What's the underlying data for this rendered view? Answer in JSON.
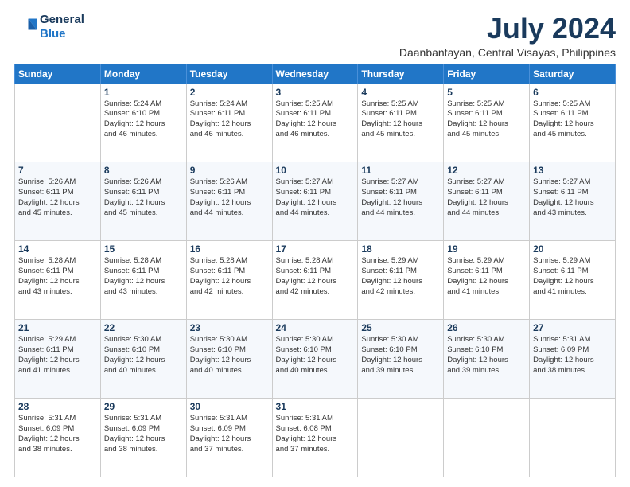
{
  "logo": {
    "line1": "General",
    "line2": "Blue"
  },
  "title": "July 2024",
  "location": "Daanbantayan, Central Visayas, Philippines",
  "days_of_week": [
    "Sunday",
    "Monday",
    "Tuesday",
    "Wednesday",
    "Thursday",
    "Friday",
    "Saturday"
  ],
  "weeks": [
    [
      {
        "day": "",
        "info": ""
      },
      {
        "day": "1",
        "info": "Sunrise: 5:24 AM\nSunset: 6:10 PM\nDaylight: 12 hours\nand 46 minutes."
      },
      {
        "day": "2",
        "info": "Sunrise: 5:24 AM\nSunset: 6:11 PM\nDaylight: 12 hours\nand 46 minutes."
      },
      {
        "day": "3",
        "info": "Sunrise: 5:25 AM\nSunset: 6:11 PM\nDaylight: 12 hours\nand 46 minutes."
      },
      {
        "day": "4",
        "info": "Sunrise: 5:25 AM\nSunset: 6:11 PM\nDaylight: 12 hours\nand 45 minutes."
      },
      {
        "day": "5",
        "info": "Sunrise: 5:25 AM\nSunset: 6:11 PM\nDaylight: 12 hours\nand 45 minutes."
      },
      {
        "day": "6",
        "info": "Sunrise: 5:25 AM\nSunset: 6:11 PM\nDaylight: 12 hours\nand 45 minutes."
      }
    ],
    [
      {
        "day": "7",
        "info": "Sunrise: 5:26 AM\nSunset: 6:11 PM\nDaylight: 12 hours\nand 45 minutes."
      },
      {
        "day": "8",
        "info": "Sunrise: 5:26 AM\nSunset: 6:11 PM\nDaylight: 12 hours\nand 45 minutes."
      },
      {
        "day": "9",
        "info": "Sunrise: 5:26 AM\nSunset: 6:11 PM\nDaylight: 12 hours\nand 44 minutes."
      },
      {
        "day": "10",
        "info": "Sunrise: 5:27 AM\nSunset: 6:11 PM\nDaylight: 12 hours\nand 44 minutes."
      },
      {
        "day": "11",
        "info": "Sunrise: 5:27 AM\nSunset: 6:11 PM\nDaylight: 12 hours\nand 44 minutes."
      },
      {
        "day": "12",
        "info": "Sunrise: 5:27 AM\nSunset: 6:11 PM\nDaylight: 12 hours\nand 44 minutes."
      },
      {
        "day": "13",
        "info": "Sunrise: 5:27 AM\nSunset: 6:11 PM\nDaylight: 12 hours\nand 43 minutes."
      }
    ],
    [
      {
        "day": "14",
        "info": "Sunrise: 5:28 AM\nSunset: 6:11 PM\nDaylight: 12 hours\nand 43 minutes."
      },
      {
        "day": "15",
        "info": "Sunrise: 5:28 AM\nSunset: 6:11 PM\nDaylight: 12 hours\nand 43 minutes."
      },
      {
        "day": "16",
        "info": "Sunrise: 5:28 AM\nSunset: 6:11 PM\nDaylight: 12 hours\nand 42 minutes."
      },
      {
        "day": "17",
        "info": "Sunrise: 5:28 AM\nSunset: 6:11 PM\nDaylight: 12 hours\nand 42 minutes."
      },
      {
        "day": "18",
        "info": "Sunrise: 5:29 AM\nSunset: 6:11 PM\nDaylight: 12 hours\nand 42 minutes."
      },
      {
        "day": "19",
        "info": "Sunrise: 5:29 AM\nSunset: 6:11 PM\nDaylight: 12 hours\nand 41 minutes."
      },
      {
        "day": "20",
        "info": "Sunrise: 5:29 AM\nSunset: 6:11 PM\nDaylight: 12 hours\nand 41 minutes."
      }
    ],
    [
      {
        "day": "21",
        "info": "Sunrise: 5:29 AM\nSunset: 6:11 PM\nDaylight: 12 hours\nand 41 minutes."
      },
      {
        "day": "22",
        "info": "Sunrise: 5:30 AM\nSunset: 6:10 PM\nDaylight: 12 hours\nand 40 minutes."
      },
      {
        "day": "23",
        "info": "Sunrise: 5:30 AM\nSunset: 6:10 PM\nDaylight: 12 hours\nand 40 minutes."
      },
      {
        "day": "24",
        "info": "Sunrise: 5:30 AM\nSunset: 6:10 PM\nDaylight: 12 hours\nand 40 minutes."
      },
      {
        "day": "25",
        "info": "Sunrise: 5:30 AM\nSunset: 6:10 PM\nDaylight: 12 hours\nand 39 minutes."
      },
      {
        "day": "26",
        "info": "Sunrise: 5:30 AM\nSunset: 6:10 PM\nDaylight: 12 hours\nand 39 minutes."
      },
      {
        "day": "27",
        "info": "Sunrise: 5:31 AM\nSunset: 6:09 PM\nDaylight: 12 hours\nand 38 minutes."
      }
    ],
    [
      {
        "day": "28",
        "info": "Sunrise: 5:31 AM\nSunset: 6:09 PM\nDaylight: 12 hours\nand 38 minutes."
      },
      {
        "day": "29",
        "info": "Sunrise: 5:31 AM\nSunset: 6:09 PM\nDaylight: 12 hours\nand 38 minutes."
      },
      {
        "day": "30",
        "info": "Sunrise: 5:31 AM\nSunset: 6:09 PM\nDaylight: 12 hours\nand 37 minutes."
      },
      {
        "day": "31",
        "info": "Sunrise: 5:31 AM\nSunset: 6:08 PM\nDaylight: 12 hours\nand 37 minutes."
      },
      {
        "day": "",
        "info": ""
      },
      {
        "day": "",
        "info": ""
      },
      {
        "day": "",
        "info": ""
      }
    ]
  ]
}
